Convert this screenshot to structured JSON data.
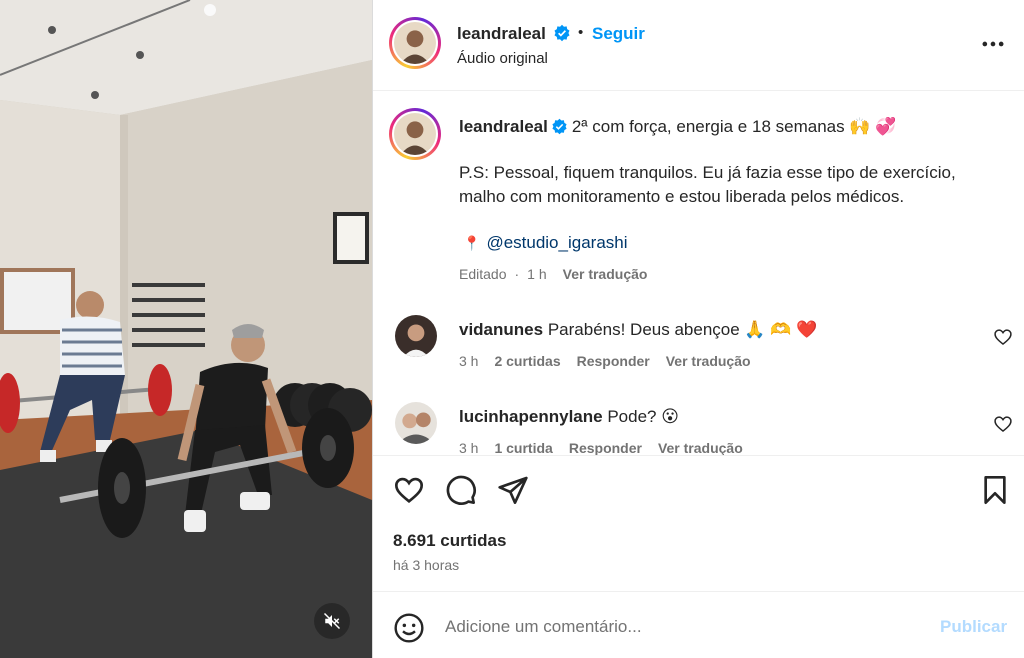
{
  "media": {
    "mute_icon": "speaker-muted-icon"
  },
  "header": {
    "username": "leandraleal",
    "verified_icon": "verified-badge-icon",
    "separator": "•",
    "follow_label": "Seguir",
    "audio_label": "Áudio original",
    "more_icon": "more-options-icon"
  },
  "caption": {
    "username": "leandraleal",
    "text": "2ª com força, energia e 18 semanas 🙌 💞",
    "ps": "P.S: Pessoal, fiquem tranquilos. Eu já fazia esse tipo de exercício, malho com monitoramento e estou liberada pelos médicos.",
    "location_pin": "📍",
    "location": "@estudio_igarashi",
    "edited": "Editado",
    "time": "1 h",
    "translate": "Ver tradução"
  },
  "comments": [
    {
      "username": "vidanunes",
      "text": "Parabéns! Deus abençoe 🙏 🫶 ❤️",
      "time": "3 h",
      "likes": "2 curtidas",
      "reply": "Responder",
      "translate": "Ver tradução"
    },
    {
      "username": "lucinhapennylane",
      "text": "Pode? 😮",
      "time": "3 h",
      "likes": "1 curtida",
      "reply": "Responder",
      "translate": "Ver tradução"
    }
  ],
  "actions": {
    "like_icon": "heart-icon",
    "comment_icon": "comment-icon",
    "share_icon": "share-icon",
    "save_icon": "bookmark-icon",
    "likes_count": "8.691 curtidas",
    "time_ago": "há 3 horas"
  },
  "composer": {
    "emoji_icon": "emoji-icon",
    "placeholder": "Adicione um comentário...",
    "publish_label": "Publicar"
  },
  "colors": {
    "accent": "#0095f6",
    "link": "#00376b",
    "muted": "#737373",
    "publish_disabled": "#b3dbff",
    "like_red": "#ed4956"
  }
}
